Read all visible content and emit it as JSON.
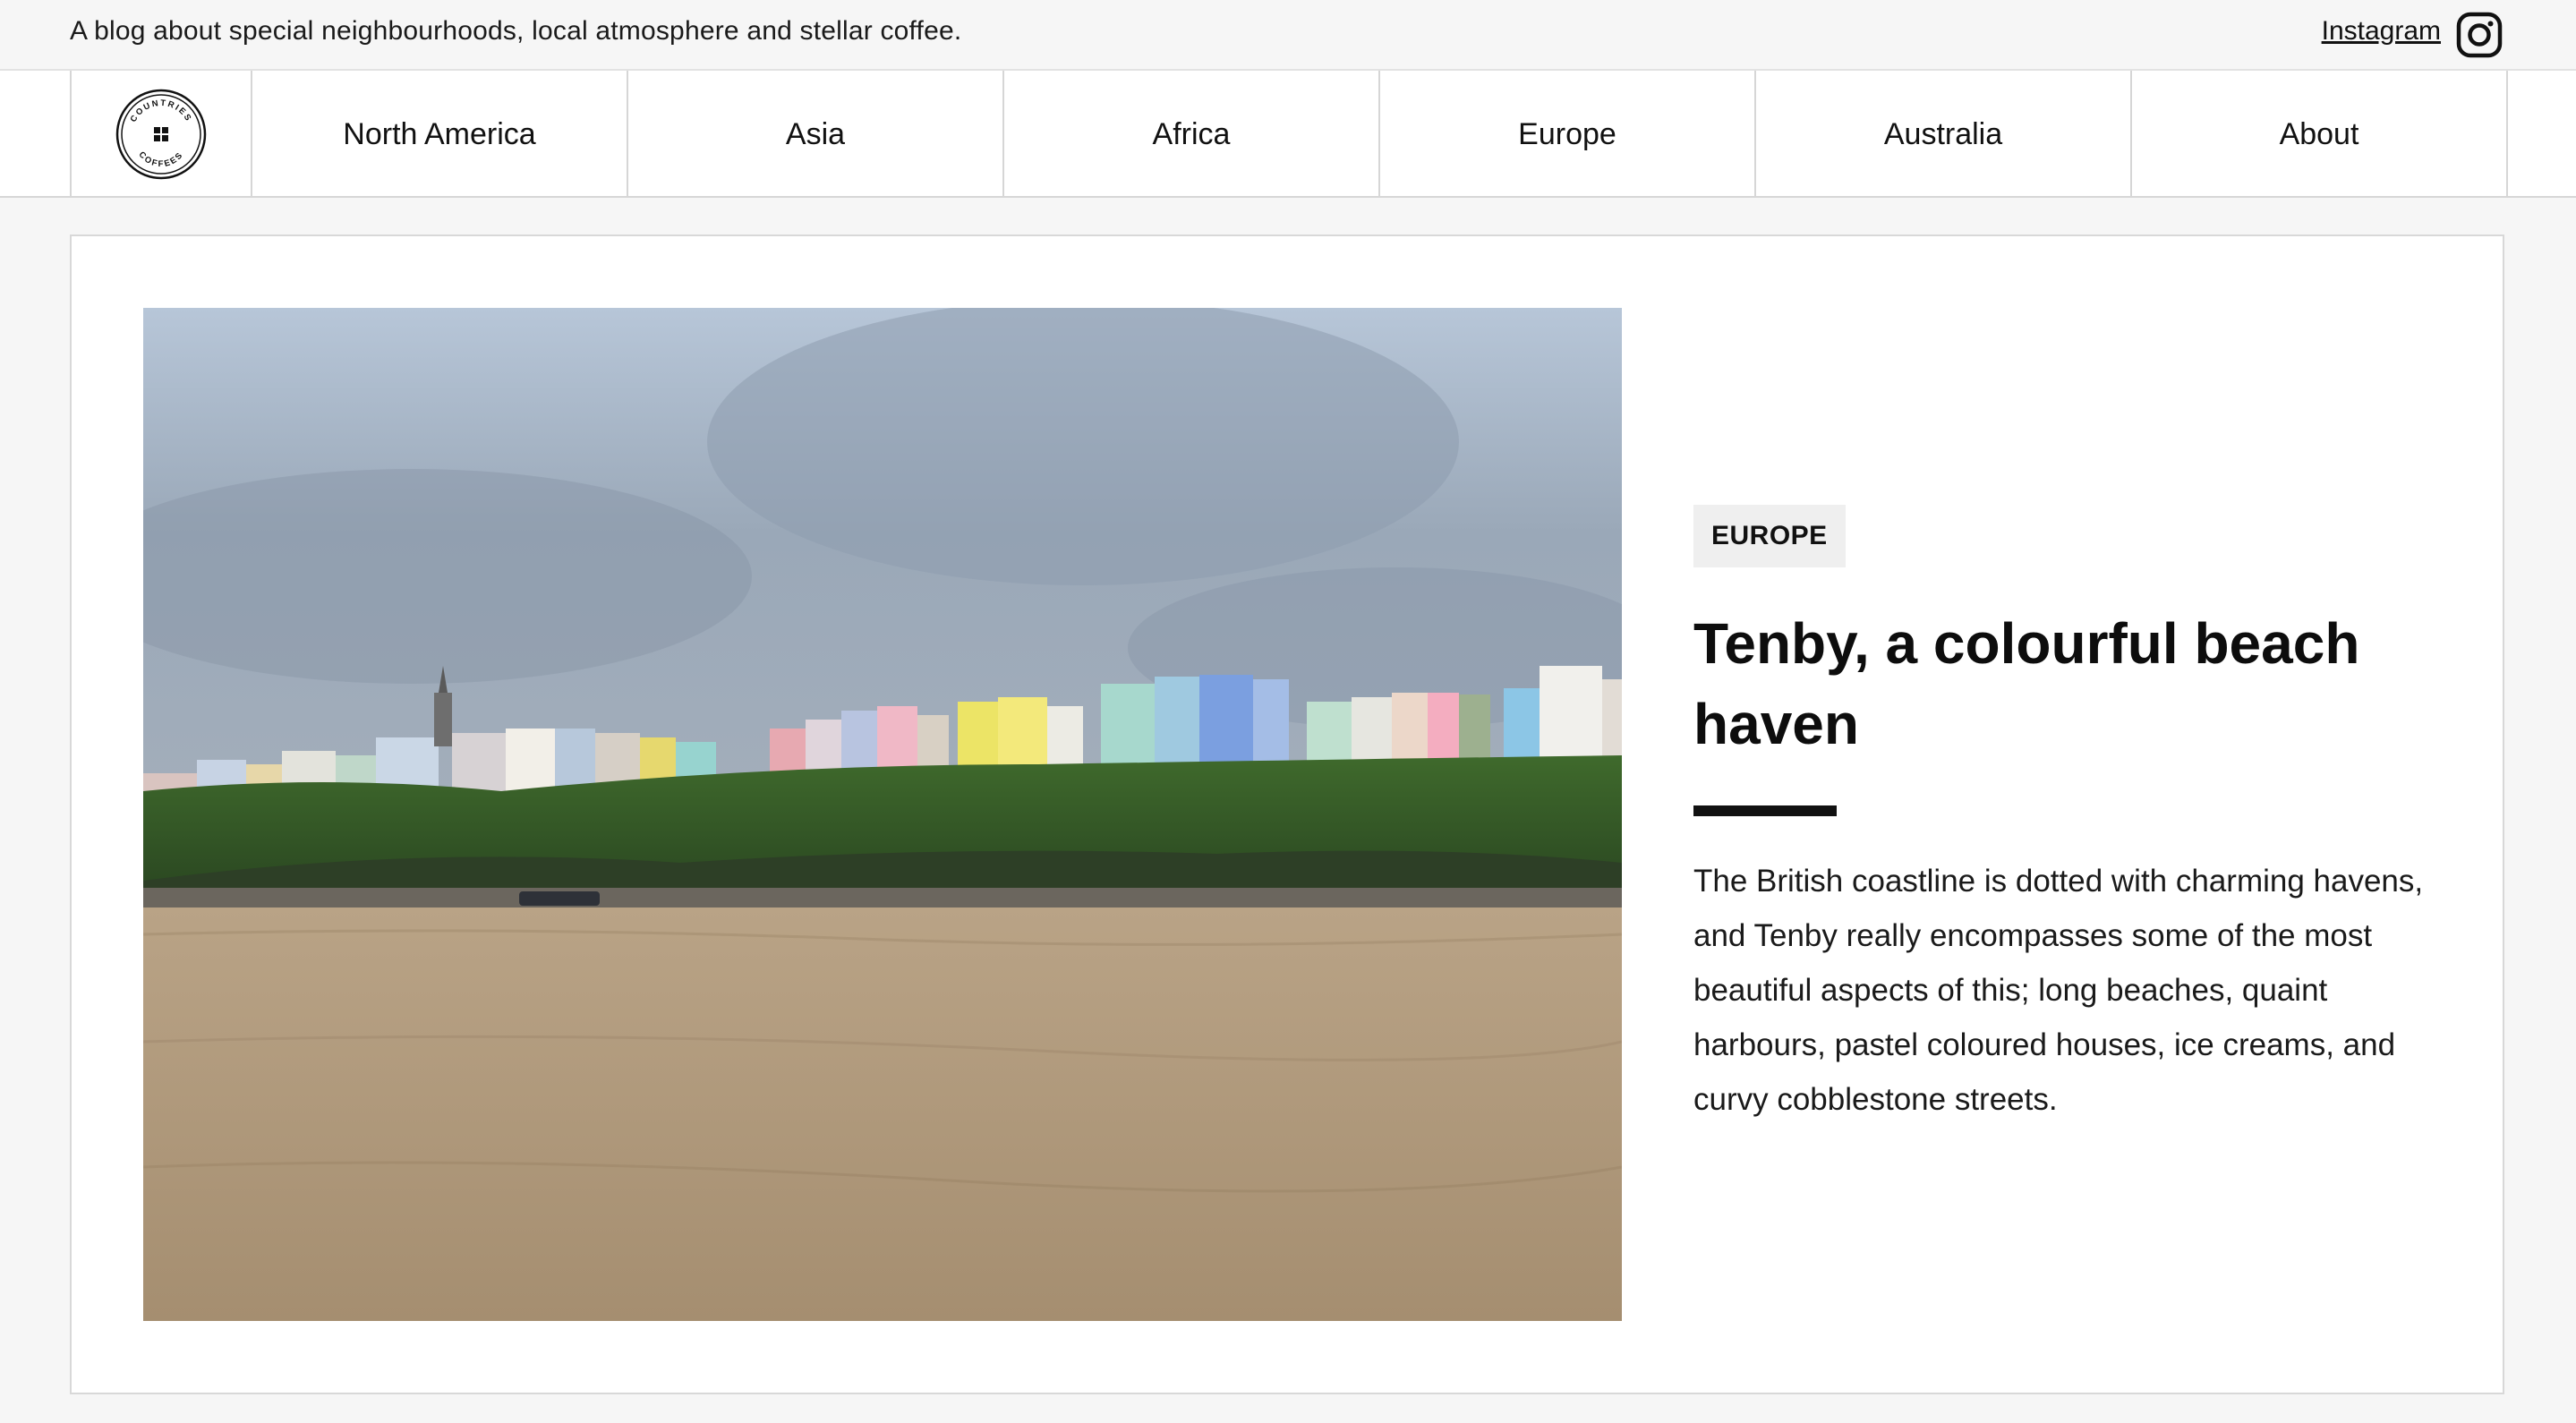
{
  "header": {
    "tagline": "A blog about special neighbourhoods, local atmosphere and stellar coffee.",
    "instagram_label": "Instagram",
    "instagram_icon": "instagram-icon"
  },
  "logo": {
    "text_top": "COUNTRIES",
    "text_bottom": "COFFEES",
    "icon": "four-squares-icon"
  },
  "nav": {
    "items": [
      {
        "label": "North America"
      },
      {
        "label": "Asia"
      },
      {
        "label": "Africa"
      },
      {
        "label": "Europe"
      },
      {
        "label": "Australia"
      },
      {
        "label": "About"
      }
    ]
  },
  "post": {
    "category": "EUROPE",
    "title": "Tenby, a colourful beach haven",
    "excerpt": "The British coastline is dotted with charming havens, and Tenby really encompasses some of the most beautiful aspects of this; long beaches, quaint harbours, pastel coloured houses, ice creams, and curvy cobblestone streets."
  },
  "colors": {
    "page_bg": "#f6f6f6",
    "card_bg": "#ffffff",
    "border": "#d6d6d6",
    "badge_bg": "#efefef",
    "text": "#111111"
  }
}
